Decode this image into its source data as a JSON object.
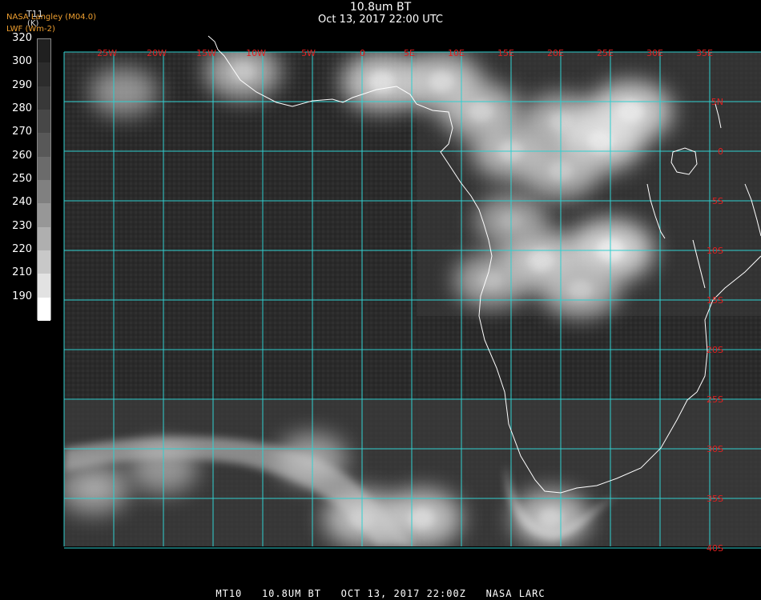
{
  "header": {
    "title": "10.8um BT",
    "subtitle": "Oct 13, 2017 22:00 UTC",
    "credit_line1": "NASA Langley (M04.0)",
    "credit_line2": "LWF (Wm-2)"
  },
  "colorbar": {
    "title": "T11",
    "unit": "(K)",
    "ticks": [
      "320",
      "300",
      "290",
      "280",
      "270",
      "260",
      "250",
      "240",
      "230",
      "220",
      "210",
      "190"
    ],
    "levels_K": [
      320,
      300,
      290,
      280,
      270,
      260,
      250,
      240,
      230,
      220,
      210,
      190
    ],
    "colors": [
      "#202020",
      "#2c2c2c",
      "#383838",
      "#474747",
      "#585858",
      "#6b6b6b",
      "#808080",
      "#979797",
      "#afafaf",
      "#c8c8c8",
      "#e2e2e2",
      "#ffffff"
    ]
  },
  "map": {
    "lon_labels": [
      "25W",
      "20W",
      "15W",
      "10W",
      "5W",
      "0",
      "5E",
      "10E",
      "15E",
      "20E",
      "25E",
      "30E",
      "35E"
    ],
    "lat_labels": [
      "5N",
      "0",
      "5S",
      "10S",
      "15S",
      "20S",
      "25S",
      "30S",
      "35S",
      "40S"
    ],
    "lon_range": [
      -30,
      35
    ],
    "lat_range": [
      -40,
      10
    ],
    "grid_color": "#30d0d0",
    "coast_color": "#ffffff",
    "label_color": "#e02020",
    "cloud_clusters": [
      {
        "lon": 2,
        "lat": 7,
        "brightness": 0.85
      },
      {
        "lon": 8,
        "lat": 7,
        "brightness": 0.8
      },
      {
        "lon": 12,
        "lat": 4,
        "brightness": 0.75
      },
      {
        "lon": 20,
        "lat": 3,
        "brightness": 0.7
      },
      {
        "lon": 27,
        "lat": 4,
        "brightness": 0.9
      },
      {
        "lon": 24,
        "lat": 1,
        "brightness": 0.9
      },
      {
        "lon": 15,
        "lat": 0,
        "brightness": 0.75
      },
      {
        "lon": 20,
        "lat": -2,
        "brightness": 0.7
      },
      {
        "lon": 25,
        "lat": -10,
        "brightness": 0.95
      },
      {
        "lon": 18,
        "lat": -11,
        "brightness": 0.85
      },
      {
        "lon": 22,
        "lat": -14,
        "brightness": 0.7
      },
      {
        "lon": 13,
        "lat": -13,
        "brightness": 0.65
      },
      {
        "lon": 15,
        "lat": -7,
        "brightness": 0.6
      },
      {
        "lon": -12,
        "lat": 8,
        "brightness": 0.7
      },
      {
        "lon": -24,
        "lat": 6,
        "brightness": 0.5
      },
      {
        "lon": -27,
        "lat": -34,
        "brightness": 0.55
      },
      {
        "lon": -20,
        "lat": -32,
        "brightness": 0.5
      },
      {
        "lon": 0,
        "lat": -37,
        "brightness": 0.75
      },
      {
        "lon": 6,
        "lat": -37,
        "brightness": 0.8
      },
      {
        "lon": 19,
        "lat": -37,
        "brightness": 0.75
      },
      {
        "lon": -5,
        "lat": -31,
        "brightness": 0.55
      }
    ]
  },
  "footer": {
    "text": "MT10   10.8UM BT   OCT 13, 2017 22:00Z   NASA LARC"
  }
}
